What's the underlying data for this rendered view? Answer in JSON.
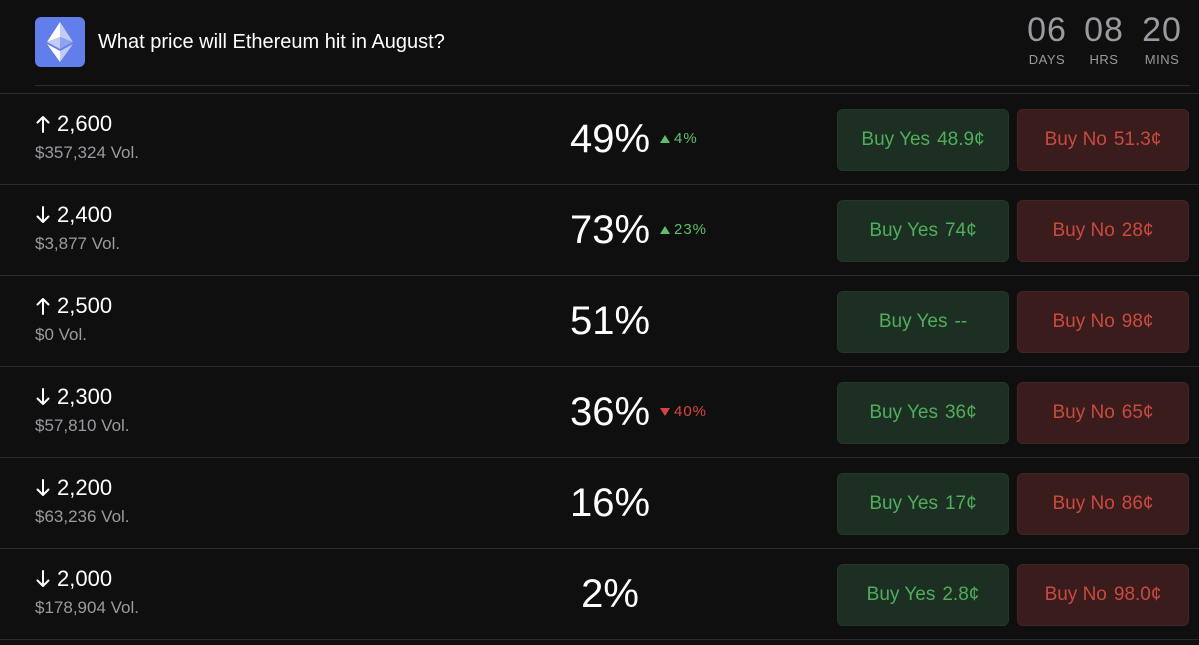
{
  "header": {
    "title": "What price will Ethereum hit in August?",
    "logo_icon": "ethereum-icon",
    "countdown": [
      {
        "value": "06",
        "unit": "DAYS"
      },
      {
        "value": "08",
        "unit": "HRS"
      },
      {
        "value": "20",
        "unit": "MINS"
      }
    ]
  },
  "markets": [
    {
      "direction": "up",
      "strike": "2,600",
      "volume": "$357,324 Vol.",
      "probability": "49%",
      "change": {
        "dir": "up",
        "value": "4%"
      },
      "yes_label": "Buy Yes",
      "yes_price": "48.9¢",
      "no_label": "Buy No",
      "no_price": "51.3¢"
    },
    {
      "direction": "down",
      "strike": "2,400",
      "volume": "$3,877 Vol.",
      "probability": "73%",
      "change": {
        "dir": "up",
        "value": "23%"
      },
      "yes_label": "Buy Yes",
      "yes_price": "74¢",
      "no_label": "Buy No",
      "no_price": "28¢"
    },
    {
      "direction": "up",
      "strike": "2,500",
      "volume": "$0 Vol.",
      "probability": "51%",
      "change": null,
      "yes_label": "Buy Yes",
      "yes_price": "--",
      "no_label": "Buy No",
      "no_price": "98¢"
    },
    {
      "direction": "down",
      "strike": "2,300",
      "volume": "$57,810 Vol.",
      "probability": "36%",
      "change": {
        "dir": "down",
        "value": "40%"
      },
      "yes_label": "Buy Yes",
      "yes_price": "36¢",
      "no_label": "Buy No",
      "no_price": "65¢"
    },
    {
      "direction": "down",
      "strike": "2,200",
      "volume": "$63,236 Vol.",
      "probability": "16%",
      "change": null,
      "yes_label": "Buy Yes",
      "yes_price": "17¢",
      "no_label": "Buy No",
      "no_price": "86¢"
    },
    {
      "direction": "down",
      "strike": "2,000",
      "volume": "$178,904 Vol.",
      "probability": "2%",
      "change": null,
      "yes_label": "Buy Yes",
      "yes_price": "2.8¢",
      "no_label": "Buy No",
      "no_price": "98.0¢"
    }
  ],
  "colors": {
    "background": "#0f0f10",
    "ethereum_brand": "#627eea",
    "yes_text": "#4fae5c",
    "yes_bg": "#1d2e22",
    "no_text": "#c94a40",
    "no_bg": "#3a1c1c",
    "change_up": "#5fbf6a",
    "change_down": "#d9453e"
  }
}
